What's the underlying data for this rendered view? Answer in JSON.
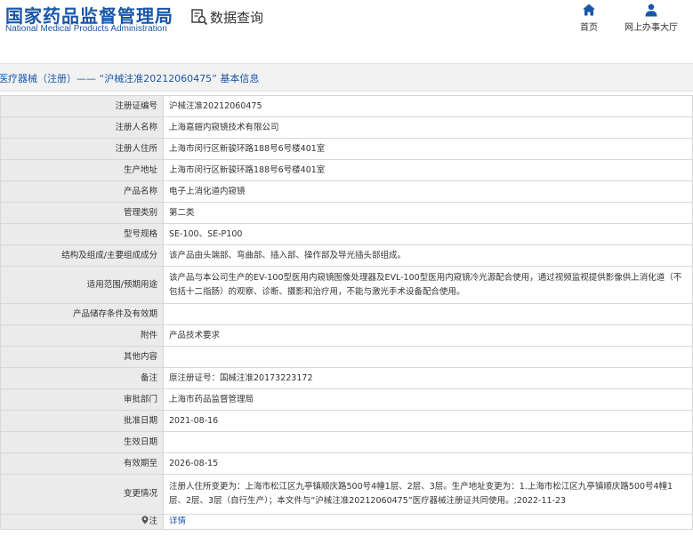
{
  "header": {
    "logo_cn": "国家药品监督管理局",
    "logo_en": "National Medical Products Administration",
    "query_label": "数据查询",
    "nav_home": "首页",
    "nav_hall": "网上办事大厅"
  },
  "title": "医疗器械（注册）—— “沪械注准20212060475” 基本信息",
  "rows": [
    {
      "key": "注册证编号",
      "value": "沪械注准20212060475"
    },
    {
      "key": "注册人名称",
      "value": "上海嘉鎧内窥镜技术有限公司"
    },
    {
      "key": "注册人住所",
      "value": "上海市闵行区新骏环路188号6号楼401室"
    },
    {
      "key": "生产地址",
      "value": "上海市闵行区新骏环路188号6号楼401室"
    },
    {
      "key": "产品名称",
      "value": "电子上消化道内窥镜"
    },
    {
      "key": "管理类别",
      "value": "第二类"
    },
    {
      "key": "型号规格",
      "value": "SE-100、SE-P100"
    },
    {
      "key": "结构及组成/主要组成成分",
      "value": "该产品由头端部、弯曲部、插入部、操作部及导光插头部组成。"
    },
    {
      "key": "适用范围/预期用途",
      "value": "该产品与本公司生产的EV-100型医用内窥镜图像处理器及EVL-100型医用内窥镜冷光源配合使用，通过视频监视提供影像供上消化道（不包括十二指肠）的观察、诊断、摄影和治疗用，不能与激光手术设备配合使用。"
    },
    {
      "key": "产品储存条件及有效期",
      "value": ""
    },
    {
      "key": "附件",
      "value": "产品技术要求"
    },
    {
      "key": "其他内容",
      "value": ""
    },
    {
      "key": "备注",
      "value": "原注册证号：国械注准20173223172"
    },
    {
      "key": "审批部门",
      "value": "上海市药品监督管理局"
    },
    {
      "key": "批准日期",
      "value": "2021-08-16"
    },
    {
      "key": "生效日期",
      "value": ""
    },
    {
      "key": "有效期至",
      "value": "2026-08-15"
    },
    {
      "key": "变更情况",
      "value": "注册人住所变更为：上海市松江区九亭镇顺庆路500号4幢1层、2层、3层。生产地址变更为：1.上海市松江区九亭镇顺庆路500号4幢1层、2层、3层（自行生产）；本文件与“沪械注准20212060475”医疗器械注册证共同使用。;2022-11-23"
    }
  ],
  "note": {
    "key": "注",
    "icon": "location-pin-icon",
    "link_text": "详情"
  },
  "colors": {
    "brand": "#1a56a8",
    "key_bg": "#ebebeb",
    "title_bg": "#f2f2f2",
    "border": "#d8d8d8"
  }
}
